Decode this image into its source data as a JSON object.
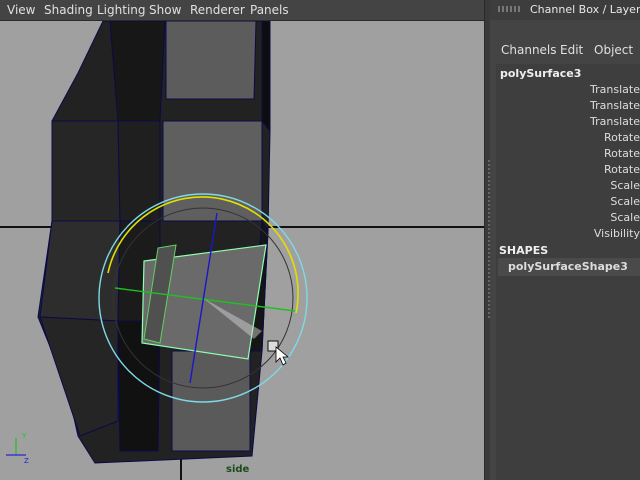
{
  "viewport_menu": [
    "View",
    "Shading",
    "Lighting",
    "Show",
    "Renderer",
    "Panels"
  ],
  "camera": "side",
  "channel_box": {
    "title": "Channel Box / Layer Edit",
    "menus": [
      "Channels",
      "Edit",
      "Object"
    ],
    "object_name": "polySurface3",
    "attributes": [
      "Translate",
      "Translate",
      "Translate",
      "Rotate",
      "Rotate",
      "Rotate",
      "Scale",
      "Scale",
      "Scale",
      "Visibility"
    ],
    "shapes_header": "SHAPES",
    "shape_name": "polySurfaceShape3"
  },
  "axis_indicator": [
    "Y",
    "Z"
  ],
  "colors": {
    "viewport_bg": "#a0a0a0",
    "panel_bg": "#444444",
    "wire": "#1a1a8a",
    "rotate_x_ring": "#e0e000",
    "rotate_y_axis": "#20c020",
    "rotate_z_axis": "#1818c8",
    "outer_ring": "#7fd9e6"
  }
}
